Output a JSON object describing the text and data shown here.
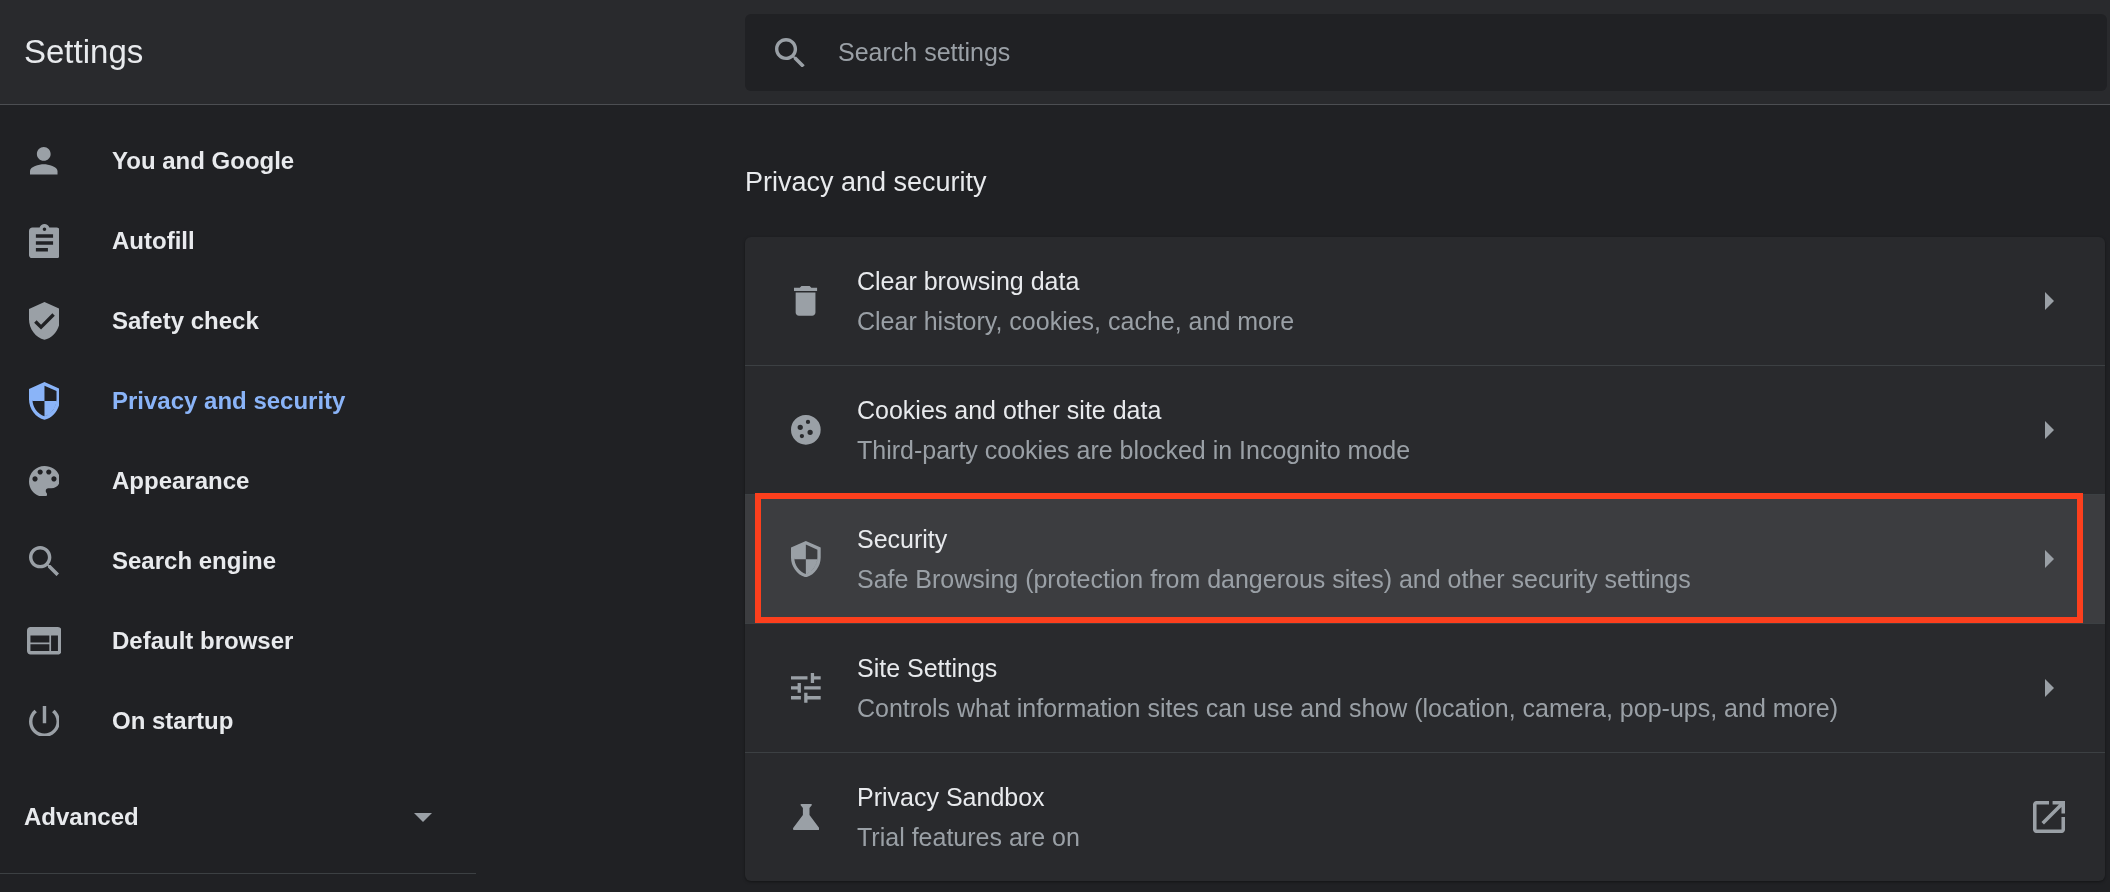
{
  "header": {
    "title": "Settings",
    "search": {
      "placeholder": "Search settings"
    }
  },
  "sidebar": {
    "items": [
      {
        "label": "You and Google",
        "selected": false
      },
      {
        "label": "Autofill",
        "selected": false
      },
      {
        "label": "Safety check",
        "selected": false
      },
      {
        "label": "Privacy and security",
        "selected": true
      },
      {
        "label": "Appearance",
        "selected": false
      },
      {
        "label": "Search engine",
        "selected": false
      },
      {
        "label": "Default browser",
        "selected": false
      },
      {
        "label": "On startup",
        "selected": false
      }
    ],
    "advanced": {
      "label": "Advanced",
      "expanded": false
    }
  },
  "section": {
    "title": "Privacy and security",
    "rows": [
      {
        "title": "Clear browsing data",
        "subtitle": "Clear history, cookies, cache, and more",
        "kind": "subpage",
        "hovered": false,
        "annotated": false
      },
      {
        "title": "Cookies and other site data",
        "subtitle": "Third-party cookies are blocked in Incognito mode",
        "kind": "subpage",
        "hovered": false,
        "annotated": false
      },
      {
        "title": "Security",
        "subtitle": "Safe Browsing (protection from dangerous sites) and other security settings",
        "kind": "subpage",
        "hovered": true,
        "annotated": true
      },
      {
        "title": "Site Settings",
        "subtitle": "Controls what information sites can use and show (location, camera, pop-ups, and more)",
        "kind": "subpage",
        "hovered": false,
        "annotated": false
      },
      {
        "title": "Privacy Sandbox",
        "subtitle": "Trial features are on",
        "kind": "external",
        "hovered": false,
        "annotated": false
      }
    ]
  }
}
